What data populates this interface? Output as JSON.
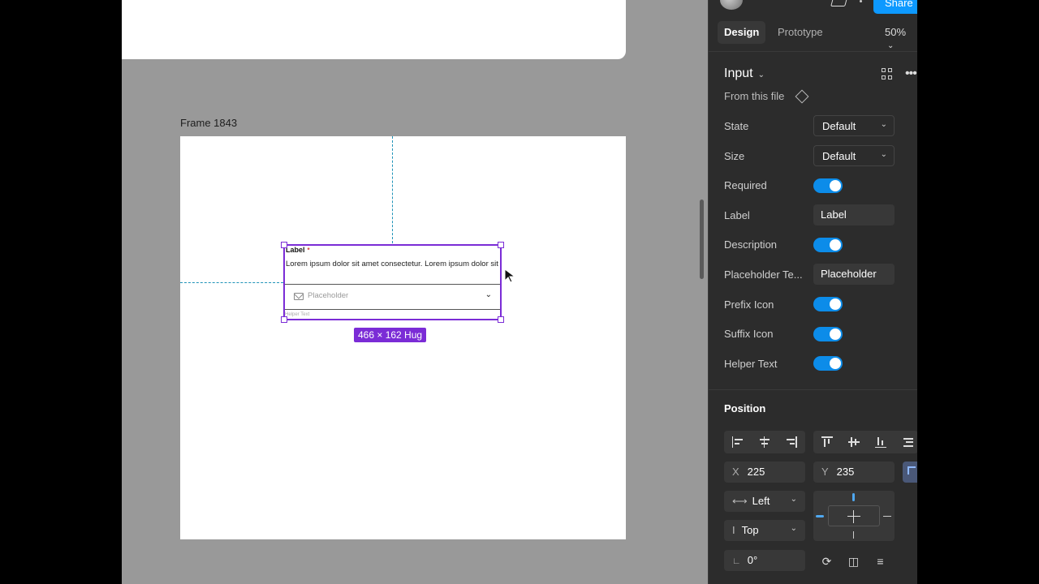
{
  "canvas": {
    "frame_title": "Frame 1843",
    "component": {
      "label": "Label",
      "required_mark": "*",
      "description": "Lorem ipsum dolor sit amet consectetur. Lorem ipsum dolor sit",
      "placeholder": "Placeholder",
      "helper_text": "Helper Text"
    },
    "size_badge": "466 × 162 Hug"
  },
  "panel": {
    "header": {
      "share_label": "Share"
    },
    "tabs": {
      "design": "Design",
      "prototype": "Prototype"
    },
    "zoom": "50%",
    "component_name": "Input",
    "from_file": "From this file",
    "props": {
      "state_label": "State",
      "state_value": "Default",
      "size_label": "Size",
      "size_value": "Default",
      "required_label": "Required",
      "required_on": true,
      "label_label": "Label",
      "label_value": "Label",
      "description_label": "Description",
      "description_on": true,
      "placeholder_label": "Placeholder Te...",
      "placeholder_value": "Placeholder",
      "prefix_label": "Prefix Icon",
      "prefix_on": true,
      "suffix_label": "Suffix Icon",
      "suffix_on": true,
      "helper_label": "Helper Text",
      "helper_on": true
    },
    "position": {
      "title": "Position",
      "x_key": "X",
      "x_value": "225",
      "y_key": "Y",
      "y_value": "235",
      "h_constraint": "Left",
      "v_constraint": "Top",
      "rotation": "0°"
    }
  },
  "colors": {
    "accent": "#0c8ce9",
    "selection": "#7b2cd6",
    "panel_bg": "#2c2c2c",
    "canvas_bg": "#999999"
  }
}
